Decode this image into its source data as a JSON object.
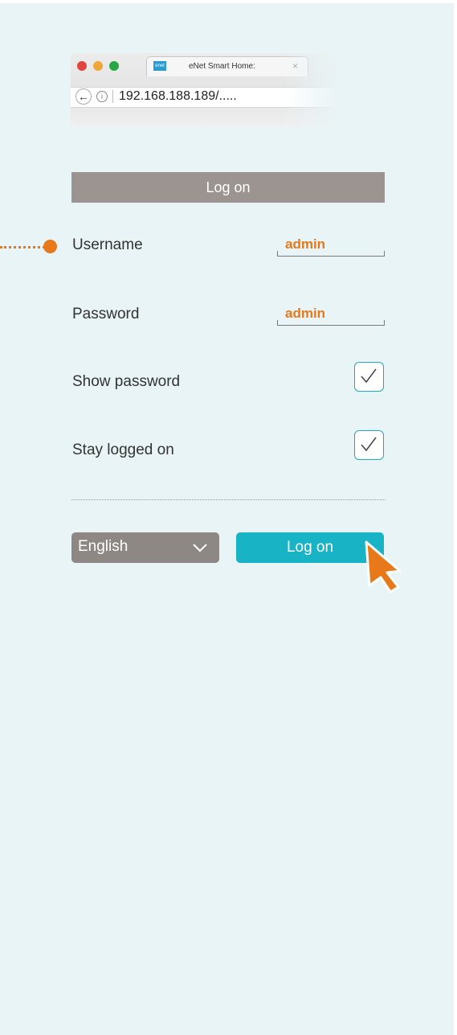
{
  "browser": {
    "tab_title": "eNet Smart Home:",
    "favicon_text": "enet",
    "close_glyph": "×",
    "back_glyph": "←",
    "info_glyph": "i",
    "url": "192.168.188.189/....."
  },
  "form": {
    "title": "Log on",
    "username_label": "Username",
    "username_value": "admin",
    "password_label": "Password",
    "password_value": "admin",
    "show_password_label": "Show password",
    "show_password_checked": true,
    "stay_logged_on_label": "Stay logged on",
    "stay_logged_on_checked": true
  },
  "footer": {
    "language_selected": "English",
    "logon_button_label": "Log on"
  },
  "colors": {
    "accent_orange": "#e8791a",
    "button_teal": "#19b3c6",
    "header_gray": "#9b9490",
    "background": "#e9f4f6"
  },
  "icons": [
    "chevron-down-icon",
    "checkmark-icon",
    "arrow-cursor-icon",
    "back-arrow-icon",
    "info-icon",
    "close-icon"
  ]
}
